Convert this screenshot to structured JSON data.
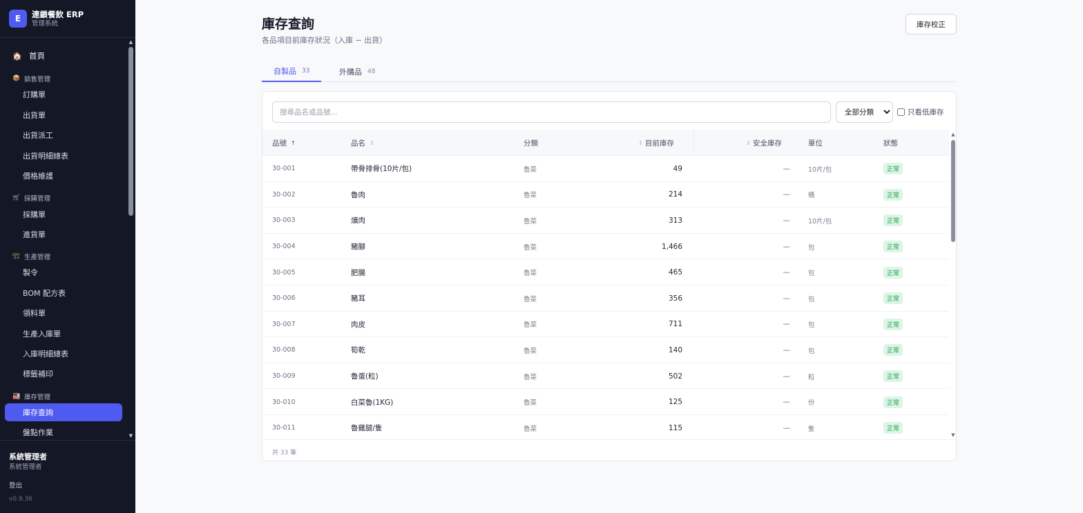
{
  "app": {
    "logo_letter": "E",
    "name": "連鎖餐飲 ERP",
    "subtitle": "管理系統"
  },
  "sidebar": {
    "home": {
      "icon": "🏠",
      "label": "首頁"
    },
    "groups": [
      {
        "icon": "📦",
        "label": "銷售管理",
        "items": [
          "訂購單",
          "出貨單",
          "出貨派工",
          "出貨明細總表",
          "價格維護"
        ]
      },
      {
        "icon": "🛒",
        "label": "採購管理",
        "items": [
          "採購單",
          "進貨單"
        ]
      },
      {
        "icon": "🏗",
        "label": "生產管理",
        "items": [
          "製令",
          "BOM 配方表",
          "領料單",
          "生產入庫單",
          "入庫明細總表",
          "標籤補印"
        ]
      },
      {
        "icon": "🏭",
        "label": "庫存管理",
        "items": [
          "庫存查詢",
          "盤點作業"
        ]
      }
    ],
    "active_item": "庫存查詢",
    "user": {
      "name": "系統管理者",
      "role": "系統管理者",
      "logout": "登出",
      "version": "v0.9.36"
    }
  },
  "page": {
    "title": "庫存查詢",
    "subtitle": "各品項目前庫存狀況（入庫 − 出貨）",
    "calibrate_button": "庫存校正"
  },
  "tabs": [
    {
      "label": "自製品",
      "count": "33",
      "active": true
    },
    {
      "label": "外購品",
      "count": "48",
      "active": false
    }
  ],
  "filters": {
    "search_placeholder": "搜尋品名或品號...",
    "category_selected": "全部分類",
    "low_stock_label": "只看低庫存"
  },
  "table": {
    "headers": {
      "code": "品號",
      "code_sort": "↑",
      "name": "品名",
      "name_sort": "↕",
      "category": "分類",
      "qty": "目前庫存",
      "qty_sort": "↕",
      "safety": "安全庫存",
      "safety_sort": "↕",
      "unit": "單位",
      "status": "狀態"
    },
    "rows": [
      {
        "code": "30-001",
        "name": "帶骨排骨(10片/包)",
        "category": "魯菜",
        "qty": "49",
        "safety": "—",
        "unit": "10片/包",
        "status": "正常"
      },
      {
        "code": "30-002",
        "name": "魯肉",
        "category": "魯菜",
        "qty": "214",
        "safety": "—",
        "unit": "桶",
        "status": "正常"
      },
      {
        "code": "30-003",
        "name": "爌肉",
        "category": "魯菜",
        "qty": "313",
        "safety": "—",
        "unit": "10片/包",
        "status": "正常"
      },
      {
        "code": "30-004",
        "name": "豬腳",
        "category": "魯菜",
        "qty": "1,466",
        "safety": "—",
        "unit": "包",
        "status": "正常"
      },
      {
        "code": "30-005",
        "name": "肥腸",
        "category": "魯菜",
        "qty": "465",
        "safety": "—",
        "unit": "包",
        "status": "正常"
      },
      {
        "code": "30-006",
        "name": "豬耳",
        "category": "魯菜",
        "qty": "356",
        "safety": "—",
        "unit": "包",
        "status": "正常"
      },
      {
        "code": "30-007",
        "name": "肉皮",
        "category": "魯菜",
        "qty": "711",
        "safety": "—",
        "unit": "包",
        "status": "正常"
      },
      {
        "code": "30-008",
        "name": "筍乾",
        "category": "魯菜",
        "qty": "140",
        "safety": "—",
        "unit": "包",
        "status": "正常"
      },
      {
        "code": "30-009",
        "name": "魯蛋(粒)",
        "category": "魯菜",
        "qty": "502",
        "safety": "—",
        "unit": "粒",
        "status": "正常"
      },
      {
        "code": "30-010",
        "name": "白菜魯(1KG)",
        "category": "魯菜",
        "qty": "125",
        "safety": "—",
        "unit": "份",
        "status": "正常"
      },
      {
        "code": "30-011",
        "name": "魯雞腿/隻",
        "category": "魯菜",
        "qty": "115",
        "safety": "—",
        "unit": "隻",
        "status": "正常"
      }
    ],
    "total": "共 33 筆"
  },
  "colors": {
    "sidebar_bg": "#141826",
    "accent": "#4f5bf0",
    "status_ok_bg": "#dcf5e4",
    "status_ok_text": "#1f9d55"
  }
}
